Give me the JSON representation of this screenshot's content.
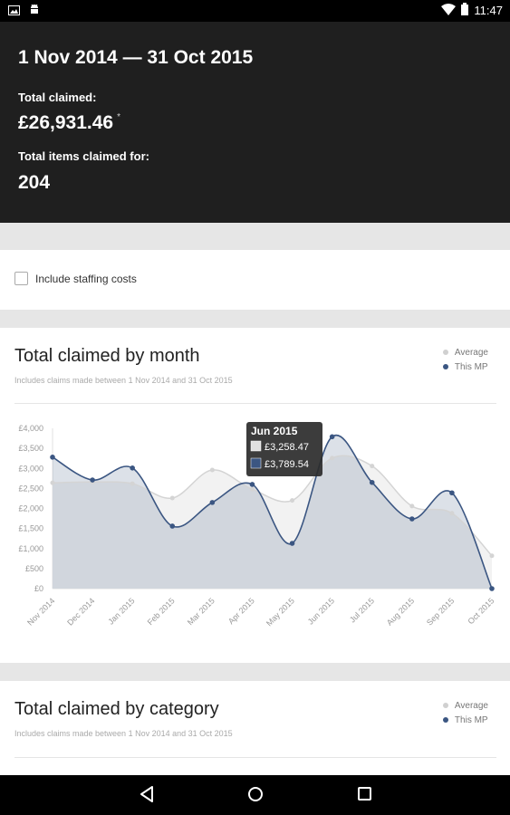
{
  "status_bar": {
    "time": "11:47"
  },
  "summary": {
    "period": "1 Nov 2014 — 31 Oct 2015",
    "total_claimed_label": "Total claimed:",
    "total_claimed_value": "£26,931.46",
    "total_claimed_note": "*",
    "total_items_label": "Total items claimed for:",
    "total_items_value": "204"
  },
  "options": {
    "include_staffing_label": "Include staffing costs",
    "include_staffing_checked": false
  },
  "month_card": {
    "title": "Total claimed by month",
    "subtitle": "Includes claims made between 1 Nov 2014 and 31 Oct 2015",
    "legend": [
      {
        "name": "Average",
        "color": "#d0d0d0"
      },
      {
        "name": "This MP",
        "color": "#3b5682"
      }
    ]
  },
  "category_card": {
    "title": "Total claimed by category",
    "subtitle": "Includes claims made between 1 Nov 2014 and 31 Oct 2015",
    "legend": [
      {
        "name": "Average",
        "color": "#d0d0d0"
      },
      {
        "name": "This MP",
        "color": "#3b5682"
      }
    ]
  },
  "chart_data": {
    "type": "area",
    "categories": [
      "Nov 2014",
      "Dec 2014",
      "Jan 2015",
      "Feb 2015",
      "Mar 2015",
      "Apr 2015",
      "May 2015",
      "Jun 2015",
      "Jul 2015",
      "Aug 2015",
      "Sep 2015",
      "Oct 2015"
    ],
    "series": [
      {
        "name": "Average",
        "values": [
          2640,
          2660,
          2620,
          2260,
          2960,
          2480,
          2200,
          3258.47,
          3060,
          2060,
          1880,
          820
        ]
      },
      {
        "name": "This MP",
        "values": [
          3280,
          2710,
          3010,
          1560,
          2150,
          2600,
          1130,
          3789.54,
          2650,
          1740,
          2390,
          0
        ]
      }
    ],
    "ylim": [
      0,
      4000
    ],
    "yticks": [
      "£0",
      "£500",
      "£1,000",
      "£1,500",
      "£2,000",
      "£2,500",
      "£3,000",
      "£3,500",
      "£4,000"
    ],
    "tooltip": {
      "title": "Jun 2015",
      "average": "£3,258.47",
      "this_mp": "£3,789.54"
    },
    "grid": false,
    "legend_position": "top-right"
  }
}
